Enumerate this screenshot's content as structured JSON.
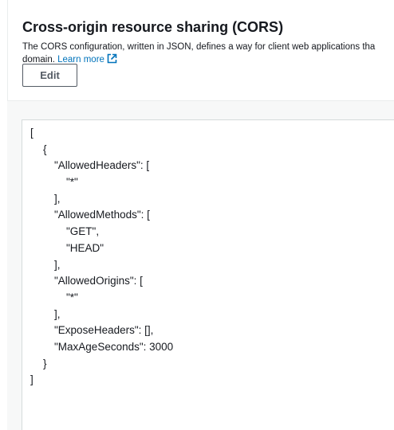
{
  "cors": {
    "title": "Cross-origin resource sharing (CORS)",
    "description_line1": "The CORS configuration, written in JSON, defines a way for client web applications tha",
    "description_line2": "domain.",
    "learn_more": "Learn more",
    "edit_label": "Edit",
    "link_color": "#0073bb",
    "code_lines": [
      {
        "indent": 0,
        "text": "["
      },
      {
        "indent": 1,
        "text": "{"
      },
      {
        "indent": 2,
        "text": "\"AllowedHeaders\": ["
      },
      {
        "indent": 3,
        "text": "\"*\""
      },
      {
        "indent": 2,
        "text": "],"
      },
      {
        "indent": 2,
        "text": "\"AllowedMethods\": ["
      },
      {
        "indent": 3,
        "text": "\"GET\","
      },
      {
        "indent": 3,
        "text": "\"HEAD\""
      },
      {
        "indent": 2,
        "text": "],"
      },
      {
        "indent": 2,
        "text": "\"AllowedOrigins\": ["
      },
      {
        "indent": 3,
        "text": "\"*\""
      },
      {
        "indent": 2,
        "text": "],"
      },
      {
        "indent": 2,
        "text": "\"ExposeHeaders\": [],"
      },
      {
        "indent": 2,
        "text": "\"MaxAgeSeconds\": 3000"
      },
      {
        "indent": 1,
        "text": "}"
      },
      {
        "indent": 0,
        "text": "]"
      }
    ]
  },
  "icons": {
    "external_link": "external-link-icon"
  }
}
